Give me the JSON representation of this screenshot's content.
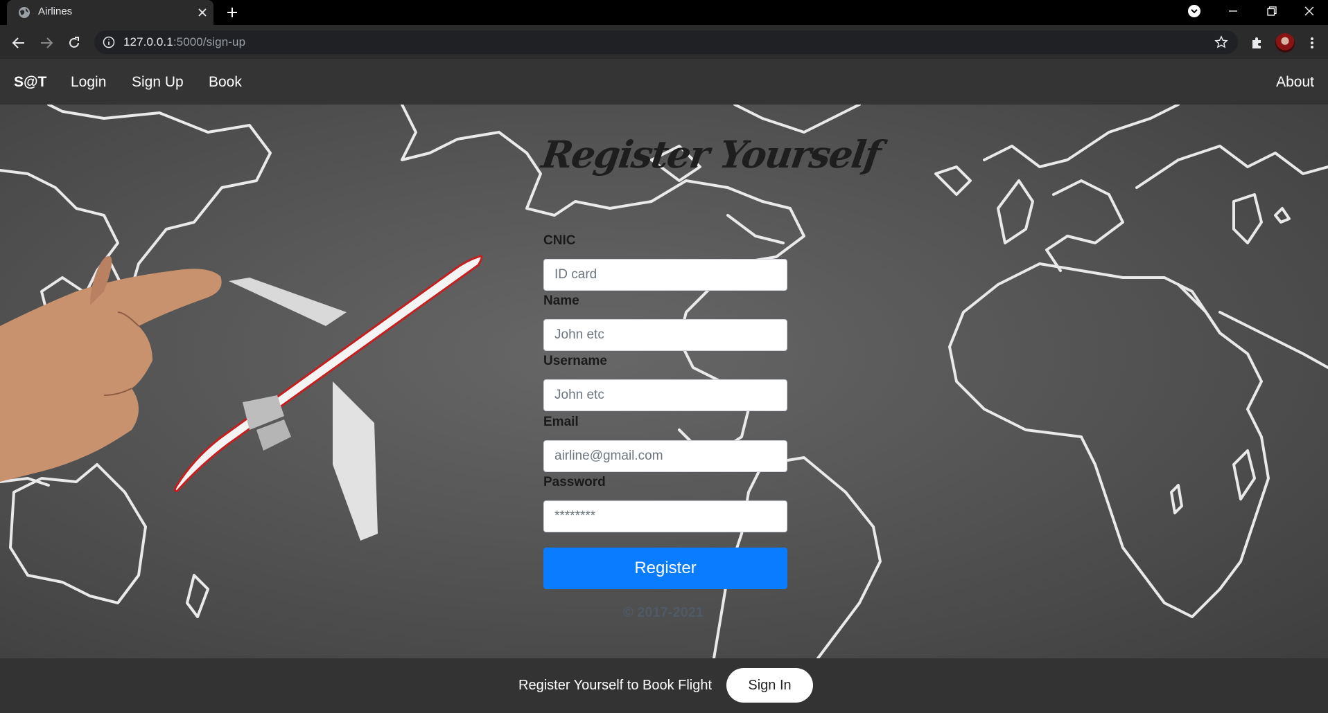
{
  "browser": {
    "tab_title": "Airlines",
    "url_host": "127.0.0.1",
    "url_path": ":5000/sign-up"
  },
  "nav": {
    "brand": "S@T",
    "links": [
      "Login",
      "Sign Up",
      "Book"
    ],
    "about": "About"
  },
  "form": {
    "title": "Register Yourself",
    "fields": [
      {
        "label": "CNIC",
        "placeholder": "ID card",
        "type": "text"
      },
      {
        "label": "Name",
        "placeholder": "John etc",
        "type": "text"
      },
      {
        "label": "Username",
        "placeholder": "John etc",
        "type": "text"
      },
      {
        "label": "Email",
        "placeholder": "airline@gmail.com",
        "type": "email"
      },
      {
        "label": "Password",
        "placeholder": "********",
        "type": "password"
      }
    ],
    "submit_label": "Register",
    "copyright": "© 2017-2021"
  },
  "footer": {
    "text": "Register Yourself to Book Flight",
    "signin_label": "Sign In"
  },
  "colors": {
    "primary_button": "#0a7cff",
    "navbar": "#343434",
    "footer": "#333333"
  }
}
